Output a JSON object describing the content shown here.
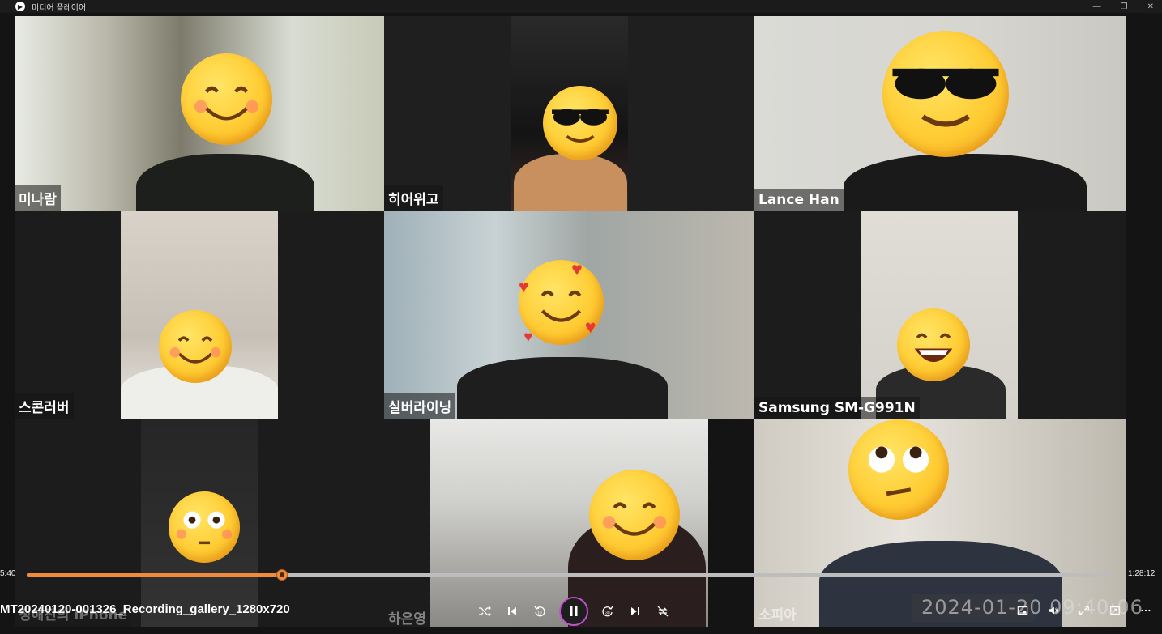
{
  "window": {
    "title": "미디어 플레이어",
    "controls": [
      "minimize-icon",
      "restore-icon",
      "close-icon"
    ]
  },
  "participants": [
    {
      "name": "미나람",
      "emoji": "smiling-blush"
    },
    {
      "name": "히어위고",
      "emoji": "sunglasses"
    },
    {
      "name": "Lance Han",
      "emoji": "sunglasses"
    },
    {
      "name": "스콘러버",
      "emoji": "smiling-blush"
    },
    {
      "name": "실버라이닝",
      "emoji": "smiling-hearts"
    },
    {
      "name": "Samsung SM-G991N",
      "emoji": "grinning"
    },
    {
      "name": "정해진의 iPhone",
      "emoji": "flushed"
    },
    {
      "name": "하은영",
      "emoji": "smiling-blush"
    },
    {
      "name": "소피아",
      "emoji": "eye-roll"
    }
  ],
  "player": {
    "elapsed": "5:40",
    "duration": "1:28:12",
    "progress": 0.235,
    "filename": "MT20240120-001326_Recording_gallery_1280x720",
    "timestamp_overlay": "2024-01-20 09:40:06",
    "accent_color": "#f08a3e",
    "play_ring_color": "#c24fd0",
    "controls": [
      "shuffle-icon",
      "previous-icon",
      "rewind-10-icon",
      "pause-icon",
      "forward-30-icon",
      "next-icon",
      "repeat-off-icon"
    ],
    "right_controls": [
      "miniplayer-icon",
      "volume-icon",
      "fullscreen-icon",
      "cast-icon",
      "more-icon"
    ]
  }
}
